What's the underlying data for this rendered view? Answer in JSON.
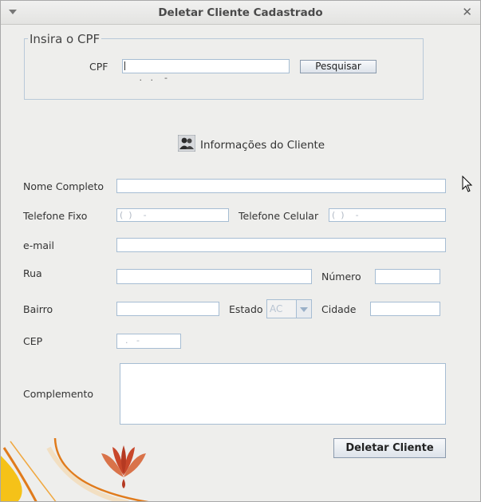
{
  "window": {
    "title": "Deletar Cliente Cadastrado"
  },
  "search": {
    "legend": "Insira o CPF",
    "cpf_label": "CPF",
    "cpf_value": " .   .    -",
    "search_button": "Pesquisar"
  },
  "section": {
    "title": "Informações do Cliente",
    "icon": "users-icon"
  },
  "form": {
    "nome_label": "Nome Completo",
    "nome_value": "",
    "telefone_fixo_label": "Telefone Fixo",
    "telefone_fixo_value": "(  )    -",
    "telefone_celular_label": "Telefone Celular",
    "telefone_celular_value": "(  )    -",
    "email_label": "e-mail",
    "email_value": "",
    "rua_label": "Rua",
    "rua_value": "",
    "numero_label": "Número",
    "numero_value": "",
    "bairro_label": "Bairro",
    "bairro_value": "",
    "estado_label": "Estado",
    "estado_value": "AC",
    "cidade_label": "Cidade",
    "cidade_value": "",
    "cep_label": "CEP",
    "cep_value": "  .   -",
    "complemento_label": "Complemento",
    "complemento_value": ""
  },
  "actions": {
    "delete_button": "Deletar Cliente"
  },
  "colors": {
    "accent_orange": "#e07b1c",
    "accent_yellow": "#f5c218",
    "logo_red": "#c8472a"
  }
}
